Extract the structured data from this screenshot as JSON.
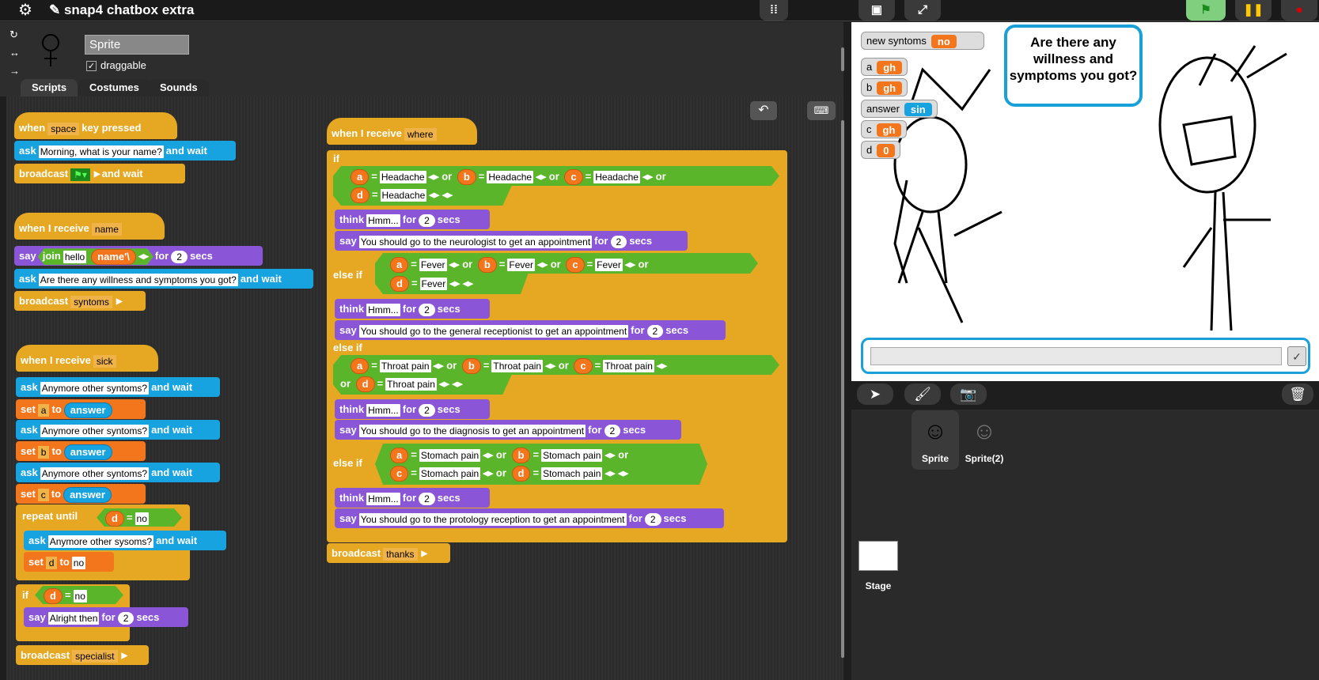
{
  "app": {
    "title": "snap4 chatbox extra"
  },
  "topbar": {
    "gear_icon": "gear-icon",
    "pencil_icon": "pencil-icon",
    "stage_buttons": [
      "footprints-icon",
      "stage-small-icon",
      "stage-full-icon"
    ],
    "green_flag_icon": "green-flag-icon",
    "pause_icon": "pause-icon",
    "stop_icon": "stop-icon"
  },
  "sprite": {
    "name": "Sprite",
    "draggable_label": "draggable",
    "draggable_checked": "✓"
  },
  "tabs": [
    "Scripts",
    "Costumes",
    "Sounds"
  ],
  "scripts": {
    "s1": {
      "hat": "when",
      "key": "space",
      "hat2": "key pressed",
      "ask": "ask",
      "ask_text": "Morning, what is your name?",
      "and_wait": "and wait",
      "broadcast": "broadcast",
      "and_wait2": "and wait"
    },
    "s2": {
      "hat": "when I receive",
      "msg": "name",
      "say": "say",
      "join": "join",
      "hello": "hello",
      "name_arg": "name'\\",
      "for": "for",
      "secs_val": "2",
      "secs": "secs",
      "ask": "ask",
      "ask_text": "Are there any willness and symptoms you got?",
      "and_wait": "and wait",
      "broadcast": "broadcast",
      "bmsg": "syntoms"
    },
    "s3": {
      "hat": "when I receive",
      "msg": "sick",
      "ask": "ask",
      "ask_text": "Anymore other syntoms?",
      "and_wait": "and wait",
      "set": "set",
      "to": "to",
      "answer": "answer",
      "var_a": "a",
      "var_b": "b",
      "var_c": "c",
      "var_d": "d",
      "repeat_until": "repeat until",
      "eq": "=",
      "no": "no",
      "ask2_text": "Anymore other sysoms?",
      "if": "if",
      "say": "say",
      "alright": "Alright then",
      "for": "for",
      "secs_val": "2",
      "secs": "secs",
      "broadcast": "broadcast",
      "bmsg": "specialist"
    },
    "s4": {
      "hat": "when I receive",
      "msg": "where",
      "if": "if",
      "else_if": "else if",
      "or": "or",
      "eq": "=",
      "think": "think",
      "hmm": "Hmm...",
      "for": "for",
      "secs_val": "2",
      "secs": "secs",
      "say": "say",
      "headache": "Headache",
      "fever": "Fever",
      "throat": "Throat pain",
      "stomach": "Stomach pain",
      "say1": "You should go to the neurologist to get an appointment",
      "say2": "You should go to the general receptionist to get an appointment",
      "say3": "You should go to the diagnosis to get an appointment",
      "say4": "You should go to the protology reception to get an appointment",
      "broadcast": "broadcast",
      "bmsg": "thanks"
    }
  },
  "stage": {
    "watchers": [
      {
        "label": "new syntoms",
        "value": "no"
      },
      {
        "label": "a",
        "value": "gh"
      },
      {
        "label": "b",
        "value": "gh"
      },
      {
        "label": "answer",
        "value": "sin"
      },
      {
        "label": "c",
        "value": "gh"
      },
      {
        "label": "d",
        "value": "0"
      }
    ],
    "bubble": "Are there any willness and symptoms you got?",
    "answer_ok": "✓"
  },
  "corral": {
    "sprites": [
      "Sprite",
      "Sprite(2)"
    ],
    "stage_label": "Stage"
  },
  "colors": {
    "events": "#e6a822",
    "sensing": "#17a3e0",
    "looks": "#8a55d7",
    "variables": "#f3761d",
    "operators": "#5bb52a"
  }
}
